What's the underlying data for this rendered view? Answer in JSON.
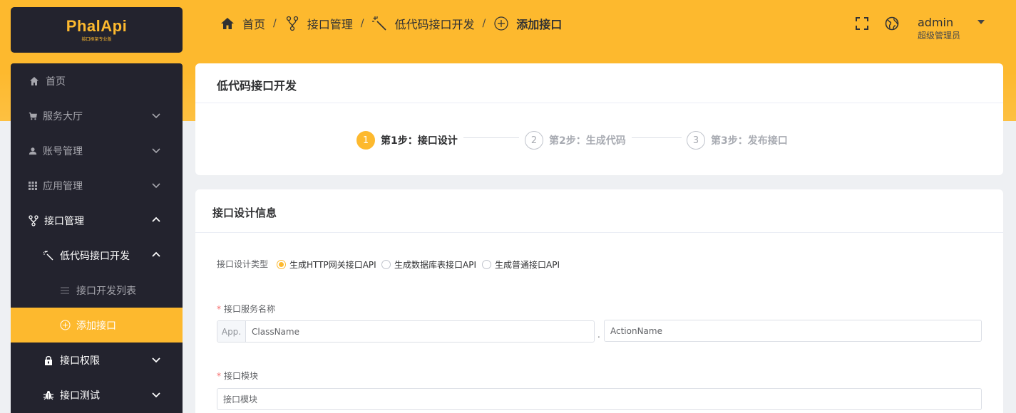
{
  "logo": {
    "text": "PhalApi",
    "subtitle": "接口框架专业版"
  },
  "sidebar": {
    "items": [
      {
        "label": "首页",
        "icon": "home-icon"
      },
      {
        "label": "服务大厅",
        "icon": "cart-icon"
      },
      {
        "label": "账号管理",
        "icon": "user-icon"
      },
      {
        "label": "应用管理",
        "icon": "grid-icon"
      },
      {
        "label": "接口管理",
        "icon": "fork-icon"
      },
      {
        "label": "低代码接口开发",
        "icon": "magic-wand-icon"
      },
      {
        "label": "接口开发列表",
        "icon": "list-icon"
      },
      {
        "label": "添加接口",
        "icon": "plus-circle-icon"
      },
      {
        "label": "接口权限",
        "icon": "lock-icon"
      },
      {
        "label": "接口测试",
        "icon": "bug-icon"
      }
    ]
  },
  "breadcrumb": {
    "items": [
      "首页",
      "接口管理",
      "低代码接口开发",
      "添加接口"
    ],
    "separator": "/"
  },
  "header": {
    "user_name": "admin",
    "user_role": "超级管理员"
  },
  "steps_card": {
    "title": "低代码接口开发",
    "steps": [
      {
        "num": "1",
        "label": "第1步：接口设计"
      },
      {
        "num": "2",
        "label": "第2步：生成代码"
      },
      {
        "num": "3",
        "label": "第3步：发布接口"
      }
    ]
  },
  "form_card": {
    "title": "接口设计信息",
    "type_label": "接口设计类型",
    "type_options": [
      "生成HTTP网关接口API",
      "生成数据库表接口API",
      "生成普通接口API"
    ],
    "selected_type": "生成HTTP网关接口API",
    "service_label": "接口服务名称",
    "service_prefix": "App.",
    "class_placeholder": "ClassName",
    "dot": ".",
    "action_placeholder": "ActionName",
    "module_label": "接口模块",
    "module_placeholder": "接口模块"
  },
  "colors": {
    "accent": "#fdb92e",
    "sidebar_bg": "#23232e",
    "required": "#f56c6c"
  }
}
